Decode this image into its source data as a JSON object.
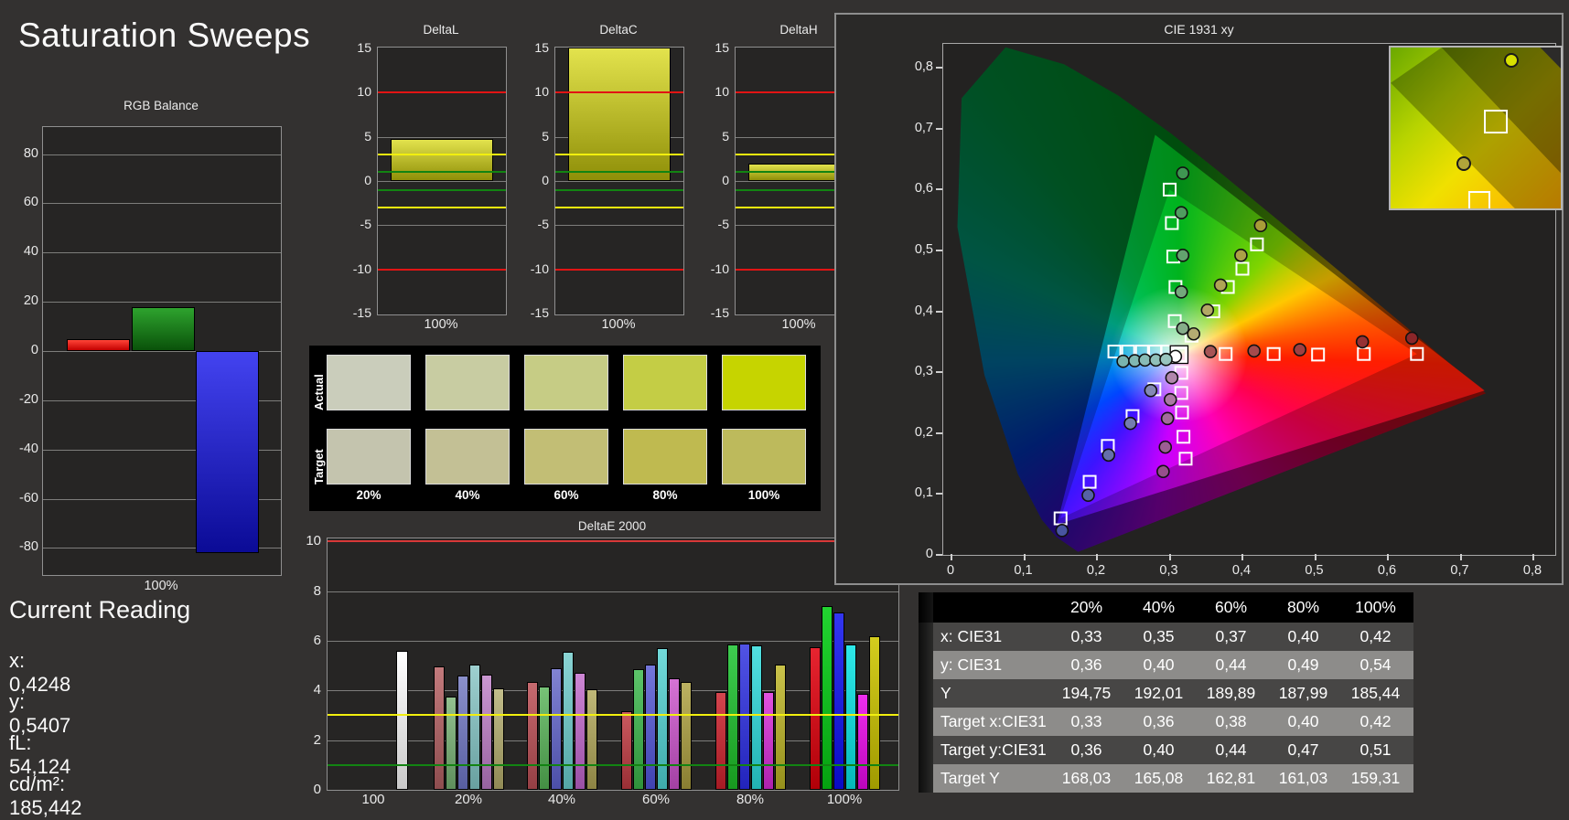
{
  "page": {
    "title": "Saturation Sweeps",
    "background": "#333130"
  },
  "rgb_balance": {
    "title": "RGB Balance",
    "xlabel": "100%",
    "ylim": [
      -91,
      91
    ],
    "yticks": [
      {
        "v": 80,
        "l": "80"
      },
      {
        "v": 60,
        "l": "60"
      },
      {
        "v": 40,
        "l": "40"
      },
      {
        "v": 20,
        "l": "20"
      },
      {
        "v": 0,
        "l": "0"
      },
      {
        "v": -20,
        "l": "-20"
      },
      {
        "v": -40,
        "l": "-40"
      },
      {
        "v": -60,
        "l": "-60"
      },
      {
        "v": -80,
        "l": "-80"
      }
    ],
    "bars": [
      {
        "name": "red",
        "value": 5,
        "grad": [
          "#ff4438",
          "#c40000"
        ]
      },
      {
        "name": "green",
        "value": 18,
        "grad": [
          "#2ea32e",
          "#0a520a"
        ]
      },
      {
        "name": "blue",
        "value": -82,
        "grad": [
          "#4343f0",
          "#0b0b96"
        ]
      }
    ]
  },
  "delta_axis": {
    "ylim": [
      -15.1,
      15.1
    ],
    "yticks": [
      {
        "v": 15,
        "l": "15"
      },
      {
        "v": 10,
        "l": "10"
      },
      {
        "v": 5,
        "l": "5"
      },
      {
        "v": 0,
        "l": "0"
      },
      {
        "v": -5,
        "l": "-5"
      },
      {
        "v": -10,
        "l": "-10"
      },
      {
        "v": -15,
        "l": "-15"
      }
    ],
    "grid_vals": [
      10,
      5,
      0,
      -5,
      -10
    ],
    "ref_lines": [
      {
        "v": 10,
        "c": "#e11414"
      },
      {
        "v": -10,
        "c": "#e11414"
      },
      {
        "v": 3,
        "c": "#f2ef0e"
      },
      {
        "v": -3,
        "c": "#f2ef0e"
      },
      {
        "v": 1,
        "c": "#128412"
      },
      {
        "v": -1,
        "c": "#128412"
      }
    ],
    "bar_grad": [
      "#e3e34d",
      "#8f8f08"
    ]
  },
  "delta_charts": [
    {
      "title": "DeltaL",
      "xlabel": "100%",
      "value": 4.8
    },
    {
      "title": "DeltaC",
      "xlabel": "100%",
      "value": 15.1
    },
    {
      "title": "DeltaH",
      "xlabel": "100%",
      "value": 2.0
    }
  ],
  "swatches": {
    "row_labels": [
      "Actual",
      "Target"
    ],
    "col_labels": [
      "20%",
      "40%",
      "60%",
      "80%",
      "100%"
    ],
    "actual": [
      "#cacdbb",
      "#c8cca2",
      "#c6cc85",
      "#c4cd45",
      "#c6d400"
    ],
    "target": [
      "#c4c4ae",
      "#c3c095",
      "#c2be75",
      "#bfba50",
      "#bdba5c"
    ]
  },
  "deltae": {
    "title": "DeltaE 2000",
    "ymax": 10.12,
    "yticks": [
      {
        "v": 0,
        "l": "0"
      },
      {
        "v": 2,
        "l": "2"
      },
      {
        "v": 4,
        "l": "4"
      },
      {
        "v": 6,
        "l": "6"
      },
      {
        "v": 8,
        "l": "8"
      },
      {
        "v": 10,
        "l": "10"
      }
    ],
    "grid_vals": [
      2,
      4,
      6,
      8
    ],
    "ref_lines": [
      {
        "v": 10,
        "c": "#d83838"
      },
      {
        "v": 3,
        "c": "#f2ef0e"
      },
      {
        "v": 1,
        "c": "#128412"
      }
    ],
    "groups": [
      {
        "label": "100",
        "offset": 30,
        "bars": [
          {
            "v": 5.6,
            "g": [
              "#ffffff",
              "#c9c9c9"
            ]
          }
        ]
      },
      {
        "label": "20%",
        "offset": 0,
        "bars": [
          {
            "v": 4.95,
            "g": [
              "#c27a7c",
              "#8e4d4f"
            ]
          },
          {
            "v": 3.75,
            "g": [
              "#93c18f",
              "#5f8f5c"
            ]
          },
          {
            "v": 4.6,
            "g": [
              "#8b90cb",
              "#585ea0"
            ]
          },
          {
            "v": 5.05,
            "g": [
              "#9ed0d0",
              "#69a0a0"
            ]
          },
          {
            "v": 4.65,
            "g": [
              "#cb97d1",
              "#9763a0"
            ]
          },
          {
            "v": 4.1,
            "g": [
              "#c2bd8b",
              "#908a55"
            ]
          }
        ]
      },
      {
        "label": "40%",
        "offset": 0,
        "bars": [
          {
            "v": 4.35,
            "g": [
              "#c66a6f",
              "#953f44"
            ]
          },
          {
            "v": 4.15,
            "g": [
              "#77c277",
              "#448f44"
            ]
          },
          {
            "v": 4.9,
            "g": [
              "#8183d2",
              "#4c4fa8"
            ]
          },
          {
            "v": 5.55,
            "g": [
              "#8ad4d4",
              "#54a6a6"
            ]
          },
          {
            "v": 4.7,
            "g": [
              "#cd86d4",
              "#9a50a5"
            ]
          },
          {
            "v": 4.05,
            "g": [
              "#bfb878",
              "#8d8444"
            ]
          }
        ]
      },
      {
        "label": "60%",
        "offset": 0,
        "bars": [
          {
            "v": 3.15,
            "g": [
              "#ca5a60",
              "#9a2f35"
            ]
          },
          {
            "v": 4.85,
            "g": [
              "#5cc46a",
              "#2f923b"
            ]
          },
          {
            "v": 5.05,
            "g": [
              "#7476da",
              "#4043b2"
            ]
          },
          {
            "v": 5.7,
            "g": [
              "#72dada",
              "#3fabab"
            ]
          },
          {
            "v": 4.5,
            "g": [
              "#d573d5",
              "#a341a3"
            ]
          },
          {
            "v": 4.35,
            "g": [
              "#bcb261",
              "#897e32"
            ]
          }
        ]
      },
      {
        "label": "80%",
        "offset": 0,
        "bars": [
          {
            "v": 3.95,
            "g": [
              "#d4454e",
              "#a61b24"
            ]
          },
          {
            "v": 5.85,
            "g": [
              "#3ecc50",
              "#17991f"
            ]
          },
          {
            "v": 5.9,
            "g": [
              "#5153e4",
              "#2224bc"
            ]
          },
          {
            "v": 5.8,
            "g": [
              "#52e0e0",
              "#22b2b2"
            ]
          },
          {
            "v": 3.95,
            "g": [
              "#e052e0",
              "#ad22ad"
            ]
          },
          {
            "v": 5.05,
            "g": [
              "#c9c24a",
              "#96901c"
            ]
          }
        ]
      },
      {
        "label": "100%",
        "offset": 0,
        "bars": [
          {
            "v": 5.75,
            "g": [
              "#e62430",
              "#b00008"
            ]
          },
          {
            "v": 7.4,
            "g": [
              "#22d430",
              "#05a010"
            ]
          },
          {
            "v": 7.15,
            "g": [
              "#3336ef",
              "#090bc4"
            ]
          },
          {
            "v": 5.85,
            "g": [
              "#2ee8e8",
              "#05b8b8"
            ]
          },
          {
            "v": 3.85,
            "g": [
              "#ee2eee",
              "#bb05bb"
            ]
          },
          {
            "v": 6.2,
            "g": [
              "#d4cc1e",
              "#a09a00"
            ]
          }
        ]
      }
    ]
  },
  "cie": {
    "title": "CIE 1931 xy",
    "xticks": [
      {
        "v": 0,
        "l": "0"
      },
      {
        "v": 0.1,
        "l": "0,1"
      },
      {
        "v": 0.2,
        "l": "0,2"
      },
      {
        "v": 0.3,
        "l": "0,3"
      },
      {
        "v": 0.4,
        "l": "0,4"
      },
      {
        "v": 0.5,
        "l": "0,5"
      },
      {
        "v": 0.6,
        "l": "0,6"
      },
      {
        "v": 0.7,
        "l": "0,7"
      },
      {
        "v": 0.8,
        "l": "0,8"
      }
    ],
    "yticks": [
      {
        "v": 0,
        "l": "0"
      },
      {
        "v": 0.1,
        "l": "0,1"
      },
      {
        "v": 0.2,
        "l": "0,2"
      },
      {
        "v": 0.3,
        "l": "0,3"
      },
      {
        "v": 0.4,
        "l": "0,4"
      },
      {
        "v": 0.5,
        "l": "0,5"
      },
      {
        "v": 0.6,
        "l": "0,6"
      },
      {
        "v": 0.7,
        "l": "0,7"
      },
      {
        "v": 0.8,
        "l": "0,8"
      }
    ],
    "srgb_triangle": [
      [
        0.64,
        0.33
      ],
      [
        0.3,
        0.6
      ],
      [
        0.15,
        0.06
      ]
    ],
    "native_triangle": [
      [
        0.733,
        0.27
      ],
      [
        0.28,
        0.69
      ],
      [
        0.145,
        0.05
      ]
    ],
    "white_point": [
      0.3127,
      0.329
    ],
    "white_target": [
      0.313,
      0.329
    ],
    "targets": [
      [
        0.377,
        0.33
      ],
      [
        0.443,
        0.33
      ],
      [
        0.504,
        0.329
      ],
      [
        0.567,
        0.33
      ],
      [
        0.64,
        0.33
      ],
      [
        0.307,
        0.384
      ],
      [
        0.308,
        0.44
      ],
      [
        0.305,
        0.49
      ],
      [
        0.303,
        0.545
      ],
      [
        0.3,
        0.6
      ],
      [
        0.279,
        0.272
      ],
      [
        0.249,
        0.228
      ],
      [
        0.215,
        0.179
      ],
      [
        0.19,
        0.12
      ],
      [
        0.15,
        0.06
      ],
      [
        0.224,
        0.334
      ],
      [
        0.243,
        0.334
      ],
      [
        0.262,
        0.334
      ],
      [
        0.28,
        0.334
      ],
      [
        0.297,
        0.334
      ],
      [
        0.316,
        0.299
      ],
      [
        0.316,
        0.266
      ],
      [
        0.317,
        0.234
      ],
      [
        0.319,
        0.194
      ],
      [
        0.322,
        0.158
      ],
      [
        0.33,
        0.36
      ],
      [
        0.36,
        0.4
      ],
      [
        0.38,
        0.44
      ],
      [
        0.4,
        0.47
      ],
      [
        0.42,
        0.51
      ]
    ],
    "measurements": [
      {
        "x": 0.308,
        "y": 0.326,
        "c": "#ffffff"
      },
      {
        "x": 0.356,
        "y": 0.334,
        "c": "#a85456"
      },
      {
        "x": 0.416,
        "y": 0.335,
        "c": "#a54a4c"
      },
      {
        "x": 0.479,
        "y": 0.337,
        "c": "#9f3f41"
      },
      {
        "x": 0.565,
        "y": 0.35,
        "c": "#963134"
      },
      {
        "x": 0.633,
        "y": 0.356,
        "c": "#8c2629"
      },
      {
        "x": 0.318,
        "y": 0.372,
        "c": "#86ad8a"
      },
      {
        "x": 0.316,
        "y": 0.432,
        "c": "#74a87c"
      },
      {
        "x": 0.318,
        "y": 0.492,
        "c": "#62a26e"
      },
      {
        "x": 0.316,
        "y": 0.562,
        "c": "#509c60"
      },
      {
        "x": 0.318,
        "y": 0.627,
        "c": "#3f9652"
      },
      {
        "x": 0.274,
        "y": 0.27,
        "c": "#8489b4"
      },
      {
        "x": 0.246,
        "y": 0.216,
        "c": "#747cb0"
      },
      {
        "x": 0.216,
        "y": 0.164,
        "c": "#656fab"
      },
      {
        "x": 0.188,
        "y": 0.098,
        "c": "#5662a6"
      },
      {
        "x": 0.152,
        "y": 0.04,
        "c": "#4855a1"
      },
      {
        "x": 0.236,
        "y": 0.318,
        "c": "#79b4ae"
      },
      {
        "x": 0.252,
        "y": 0.319,
        "c": "#80b8b2"
      },
      {
        "x": 0.266,
        "y": 0.32,
        "c": "#88bcb6"
      },
      {
        "x": 0.281,
        "y": 0.32,
        "c": "#90c0ba"
      },
      {
        "x": 0.295,
        "y": 0.321,
        "c": "#98c4be"
      },
      {
        "x": 0.303,
        "y": 0.291,
        "c": "#b287ac"
      },
      {
        "x": 0.301,
        "y": 0.255,
        "c": "#ab79a4"
      },
      {
        "x": 0.297,
        "y": 0.224,
        "c": "#a46b9c"
      },
      {
        "x": 0.294,
        "y": 0.177,
        "c": "#9d5d94"
      },
      {
        "x": 0.291,
        "y": 0.137,
        "c": "#964f8c"
      },
      {
        "x": 0.333,
        "y": 0.363,
        "c": "#b5ac72"
      },
      {
        "x": 0.352,
        "y": 0.402,
        "c": "#b2a864"
      },
      {
        "x": 0.37,
        "y": 0.443,
        "c": "#afa455"
      },
      {
        "x": 0.398,
        "y": 0.492,
        "c": "#aca047"
      },
      {
        "x": 0.425,
        "y": 0.541,
        "c": "#a99c38"
      }
    ],
    "locus": [
      [
        0.1741,
        0.005
      ],
      [
        0.144,
        0.0297
      ],
      [
        0.1241,
        0.0578
      ],
      [
        0.0913,
        0.1327
      ],
      [
        0.0454,
        0.295
      ],
      [
        0.0082,
        0.5384
      ],
      [
        0.0139,
        0.7502
      ],
      [
        0.0743,
        0.8338
      ],
      [
        0.1547,
        0.8059
      ],
      [
        0.2296,
        0.7543
      ],
      [
        0.3016,
        0.6923
      ],
      [
        0.3731,
        0.6245
      ],
      [
        0.4441,
        0.5547
      ],
      [
        0.5125,
        0.4866
      ],
      [
        0.5752,
        0.4242
      ],
      [
        0.627,
        0.3725
      ],
      [
        0.6658,
        0.334
      ],
      [
        0.6915,
        0.3083
      ],
      [
        0.7347,
        0.2653
      ]
    ],
    "inset": {
      "square": [
        0.62,
        0.46
      ],
      "square_bottom": [
        0.52,
        0.96
      ],
      "circle_low": [
        0.43,
        0.72
      ],
      "circle_low_color": "#b0a43a",
      "circle_high": [
        0.71,
        0.08
      ],
      "circle_high_color": "#d8e000"
    }
  },
  "table": {
    "headers": [
      "20%",
      "40%",
      "60%",
      "80%",
      "100%"
    ],
    "rows": [
      {
        "label": "x: CIE31",
        "values": [
          "0,33",
          "0,35",
          "0,37",
          "0,40",
          "0,42"
        ],
        "shade": "dark"
      },
      {
        "label": "y: CIE31",
        "values": [
          "0,36",
          "0,40",
          "0,44",
          "0,49",
          "0,54"
        ],
        "shade": "light"
      },
      {
        "label": "Y",
        "values": [
          "194,75",
          "192,01",
          "189,89",
          "187,99",
          "185,44"
        ],
        "shade": "dark"
      },
      {
        "label": "Target x:CIE31",
        "values": [
          "0,33",
          "0,36",
          "0,38",
          "0,40",
          "0,42"
        ],
        "shade": "light"
      },
      {
        "label": "Target y:CIE31",
        "values": [
          "0,36",
          "0,40",
          "0,44",
          "0,47",
          "0,51"
        ],
        "shade": "dark"
      },
      {
        "label": "Target Y",
        "values": [
          "168,03",
          "165,08",
          "162,81",
          "161,03",
          "159,31"
        ],
        "shade": "light"
      }
    ]
  },
  "readings": {
    "heading": "Current Reading",
    "lines": [
      "x: 0,4248",
      "y: 0,5407",
      "fL: 54,124",
      "cd/m²: 185,442"
    ]
  }
}
